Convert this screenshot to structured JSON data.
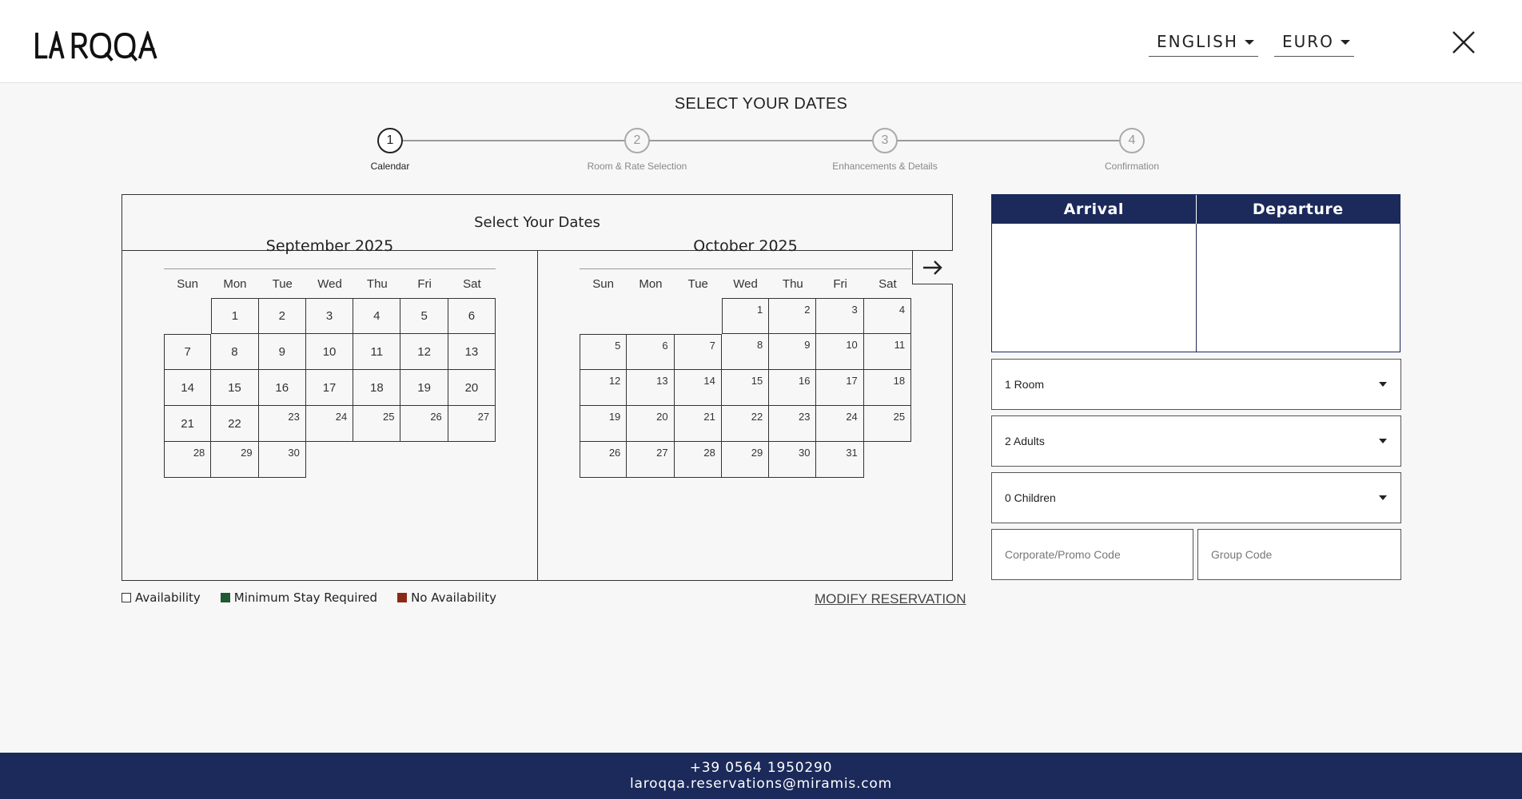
{
  "header": {
    "logo_text": "LA ROQQA",
    "language": "ENGLISH",
    "currency": "EURO"
  },
  "steps": {
    "title": "SELECT YOUR DATES",
    "items": [
      {
        "num": "1",
        "label": "Calendar",
        "active": true
      },
      {
        "num": "2",
        "label": "Room & Rate Selection",
        "active": false
      },
      {
        "num": "3",
        "label": "Enhancements & Details",
        "active": false
      },
      {
        "num": "4",
        "label": "Confirmation",
        "active": false
      }
    ]
  },
  "calendar": {
    "title": "Select Your Dates",
    "weekdays": [
      "Sun",
      "Mon",
      "Tue",
      "Wed",
      "Thu",
      "Fri",
      "Sat"
    ],
    "months": [
      {
        "title": "September 2025",
        "offset": 1,
        "days": 30,
        "centered_until": 22
      },
      {
        "title": "October 2025",
        "offset": 3,
        "days": 31,
        "centered_until": 0
      }
    ]
  },
  "legend": {
    "items": [
      {
        "label": "Availability",
        "color": "#ffffff"
      },
      {
        "label": "Minimum Stay Required",
        "color": "#1e5a32"
      },
      {
        "label": "No Availability",
        "color": "#8b2a14"
      }
    ]
  },
  "modify_label": "MODIFY RESERVATION",
  "dates": {
    "arrival_label": "Arrival",
    "departure_label": "Departure"
  },
  "booking": {
    "rooms": "1 Room",
    "adults": "2 Adults",
    "children": "0 Children",
    "promo_placeholder": "Corporate/Promo Code",
    "group_placeholder": "Group Code"
  },
  "footer": {
    "phone": "+39 0564 1950290",
    "email": "laroqqa.reservations@miramis.com"
  },
  "colors": {
    "navy": "#1b2a5a",
    "background": "#f7f7f7"
  }
}
